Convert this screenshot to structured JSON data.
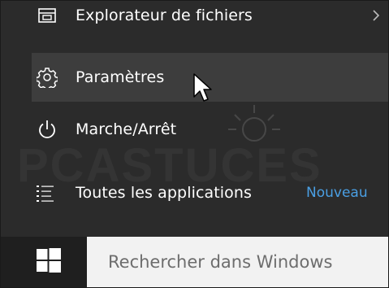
{
  "start_menu": {
    "items": [
      {
        "label": "Explorateur de fichiers",
        "icon": "file-explorer-icon",
        "has_submenu": true
      },
      {
        "label": "Paramètres",
        "icon": "gear-icon",
        "hovered": true
      },
      {
        "label": "Marche/Arrêt",
        "icon": "power-icon"
      },
      {
        "label": "Toutes les applications",
        "icon": "all-apps-list-icon",
        "badge": "Nouveau"
      }
    ]
  },
  "taskbar": {
    "start_icon": "windows-logo-icon",
    "search_placeholder": "Rechercher dans Windows"
  },
  "watermark": {
    "text": "PCASTUCES"
  },
  "colors": {
    "menu_background": "#2b2b2b",
    "hover_background": "#3d3d3d",
    "accent_link": "#4a9fe3",
    "taskbar_background": "#1f1f1f",
    "search_background": "#f2f2f2"
  }
}
